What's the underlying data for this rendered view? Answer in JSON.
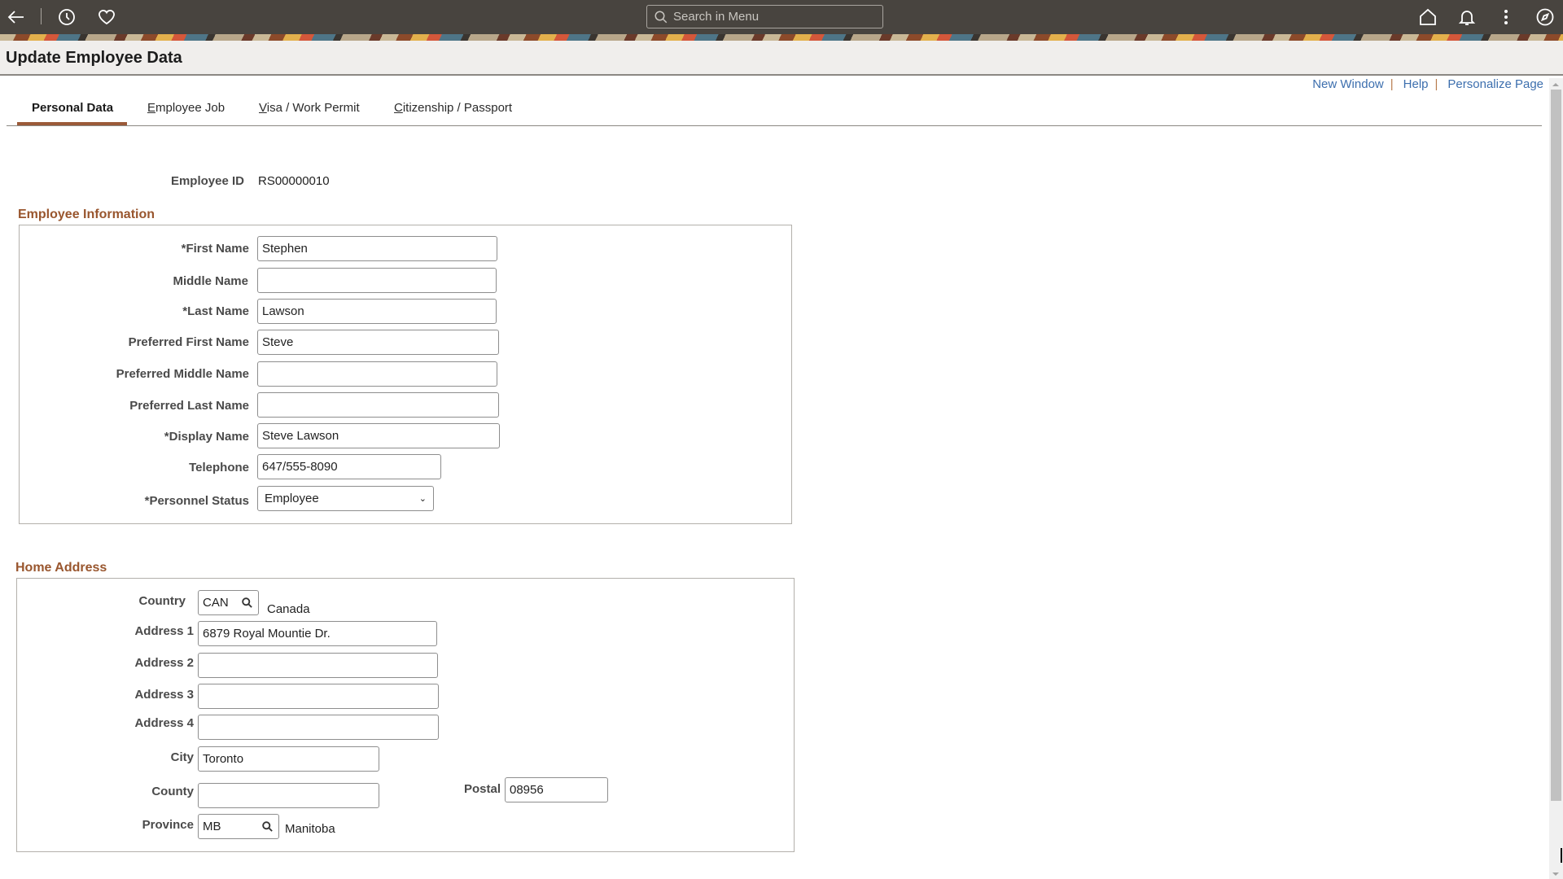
{
  "topbar": {
    "search_placeholder": "Search in Menu",
    "icons": [
      "back-arrow-icon",
      "recent-history-icon",
      "favorites-heart-icon",
      "home-icon",
      "notifications-bell-icon",
      "actions-kebab-icon",
      "navbar-compass-icon"
    ]
  },
  "header": {
    "title": "Update Employee Data"
  },
  "util_links": {
    "new_window": "New Window",
    "help": "Help",
    "personalize": "Personalize Page",
    "separator": "|"
  },
  "tabs": [
    {
      "label": "Personal Data",
      "active": true
    },
    {
      "accel": "E",
      "rest": "mployee Job",
      "active": false
    },
    {
      "accel": "V",
      "rest": "isa / Work Permit",
      "active": false
    },
    {
      "accel": "C",
      "rest": "itizenship / Passport",
      "active": false
    }
  ],
  "employee": {
    "id_label": "Employee ID",
    "id_value": "RS00000010"
  },
  "employee_info": {
    "title": "Employee Information",
    "fields": {
      "first_name": {
        "label": "*First Name",
        "value": "Stephen"
      },
      "middle_name": {
        "label": "Middle Name",
        "value": ""
      },
      "last_name": {
        "label": "*Last Name",
        "value": "Lawson"
      },
      "pref_first": {
        "label": "Preferred First Name",
        "value": "Steve"
      },
      "pref_middle": {
        "label": "Preferred Middle Name",
        "value": ""
      },
      "pref_last": {
        "label": "Preferred Last Name",
        "value": ""
      },
      "display_name": {
        "label": "*Display Name",
        "value": "Steve Lawson"
      },
      "telephone": {
        "label": "Telephone",
        "value": "647/555-8090"
      },
      "personnel_status": {
        "label": "*Personnel Status",
        "value": "Employee"
      }
    }
  },
  "home_address": {
    "title": "Home Address",
    "fields": {
      "country": {
        "label": "Country",
        "value": "CAN",
        "description": "Canada"
      },
      "address1": {
        "label": "Address 1",
        "value": "6879 Royal Mountie Dr."
      },
      "address2": {
        "label": "Address 2",
        "value": ""
      },
      "address3": {
        "label": "Address 3",
        "value": ""
      },
      "address4": {
        "label": "Address 4",
        "value": ""
      },
      "city": {
        "label": "City",
        "value": "Toronto"
      },
      "county": {
        "label": "County",
        "value": ""
      },
      "postal": {
        "label": "Postal",
        "value": "08956"
      },
      "province": {
        "label": "Province",
        "value": "MB",
        "description": "Manitoba"
      }
    }
  },
  "colors": {
    "topbar": "#48443f",
    "section_title": "#99562e",
    "tab_indicator": "#9b5a38",
    "link": "#3d6fae"
  }
}
